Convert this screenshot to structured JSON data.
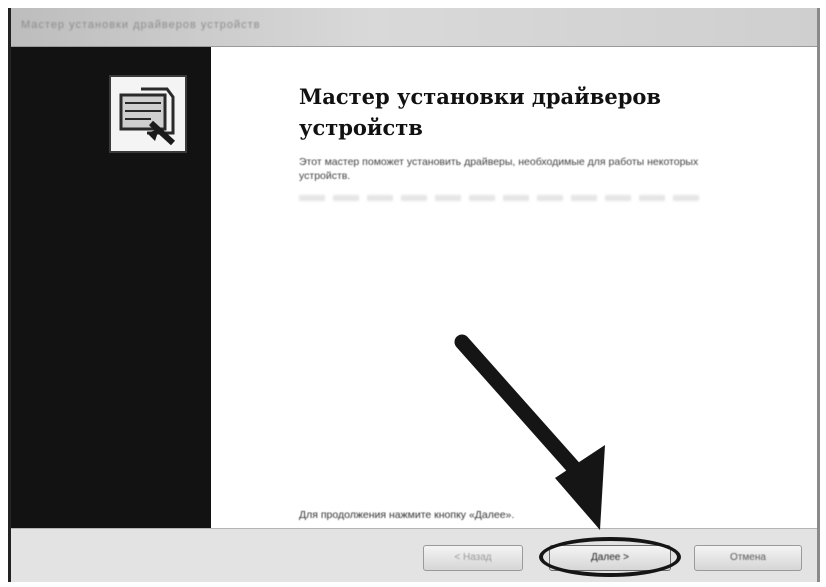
{
  "window": {
    "title": "Мастер установки драйверов устройств"
  },
  "wizard": {
    "icon": "driver-install-icon",
    "heading": "Мастер установки драйверов устройств",
    "description": "Этот мастер поможет установить драйверы, необходимые для работы некоторых устройств.",
    "continue_prompt": "Для продолжения нажмите кнопку «Далее»."
  },
  "footer": {
    "back_label": "< Назад",
    "next_label": "Далее >",
    "cancel_label": "Отмена"
  },
  "annotations": {
    "arrow_icon": "pointer-arrow-icon",
    "highlight": "next-button-highlight-ellipse"
  },
  "colors": {
    "left_panel": "#121212",
    "annotation": "#151515"
  }
}
